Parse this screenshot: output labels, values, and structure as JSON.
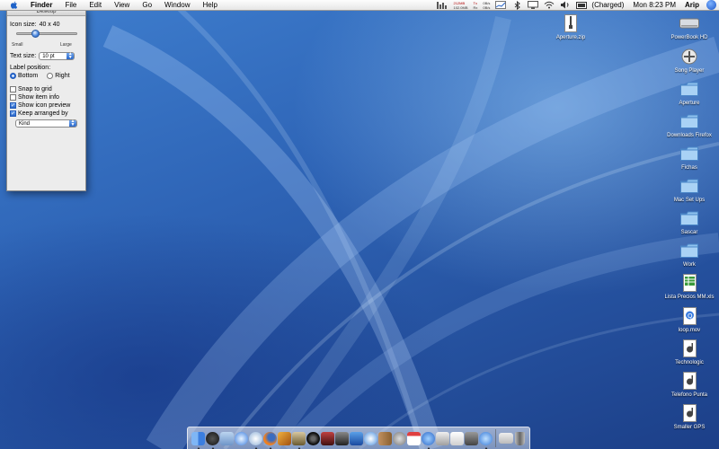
{
  "menubar": {
    "app_name": "Finder",
    "items": [
      "File",
      "Edit",
      "View",
      "Go",
      "Window",
      "Help"
    ],
    "net_up": "212MB",
    "net_down": "102.0MB",
    "net_rate_up": "0B/s",
    "net_rate_down": "0B/s",
    "tx_label": "Tx",
    "rx_label": "Rx",
    "battery": "(Charged)",
    "clock": "Mon 8:23 PM",
    "user": "Arip"
  },
  "panel": {
    "title": "Desktop",
    "icon_size_label": "Icon size:",
    "icon_size_value": "40 x 40",
    "icon_size_fraction": 0.3,
    "small_label": "Small",
    "large_label": "Large",
    "text_size_label": "Text size:",
    "text_size_value": "10 pt",
    "label_position_label": "Label position:",
    "bottom_label": "Bottom",
    "right_label": "Right",
    "snap_label": "Snap to grid",
    "item_info_label": "Show item info",
    "preview_label": "Show icon preview",
    "arranged_label": "Keep arranged by",
    "arranged_value": "Kind",
    "checks": {
      "snap": false,
      "item_info": false,
      "preview": true,
      "arranged": true
    },
    "label_position_selected": "Bottom"
  },
  "desktop_icons": [
    {
      "label": "Aperture.zip",
      "icon": "zip-icon"
    },
    {
      "label": "PowerBook HD",
      "icon": "hard-drive-icon"
    },
    {
      "label": "Song Player",
      "icon": "app-icon"
    },
    {
      "label": "Aperture",
      "icon": "folder-icon"
    },
    {
      "label": "Downloads Firefox",
      "icon": "folder-icon"
    },
    {
      "label": "Fichas",
      "icon": "folder-icon"
    },
    {
      "label": "Mac Set Ups",
      "icon": "folder-icon"
    },
    {
      "label": "Sascar",
      "icon": "folder-icon"
    },
    {
      "label": "Work",
      "icon": "folder-icon"
    },
    {
      "label": "Lista Precios MM.xls",
      "icon": "spreadsheet-icon"
    },
    {
      "label": "loop.mov",
      "icon": "movie-icon"
    },
    {
      "label": "Technologic",
      "icon": "audio-file-icon"
    },
    {
      "label": "Telefono Punta",
      "icon": "audio-file-icon"
    },
    {
      "label": "Smaller GPS",
      "icon": "audio-file-icon"
    }
  ],
  "colors": {
    "accent": "#2a66c8",
    "folder": "#8fc2ee",
    "desktop": "#2e64b6"
  }
}
